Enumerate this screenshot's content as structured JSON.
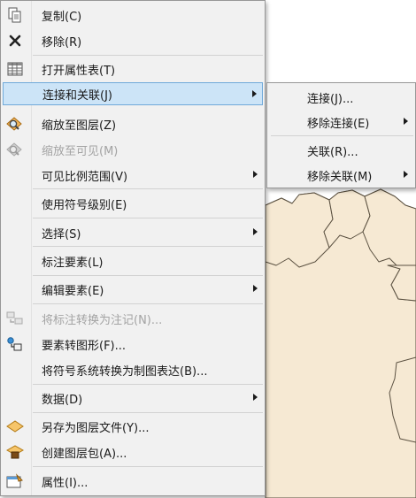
{
  "context_menu": {
    "items": [
      {
        "label": "复制(C)",
        "icon": "copy-icon"
      },
      {
        "label": "移除(R)",
        "icon": "remove-x-icon"
      },
      {
        "label": "打开属性表(T)",
        "icon": "attribute-table-icon"
      },
      {
        "label": "连接和关联(J)",
        "icon": "",
        "submenu": true,
        "highlighted": true
      },
      {
        "label": "缩放至图层(Z)",
        "icon": "zoom-to-layer-icon"
      },
      {
        "label": "缩放至可见(M)",
        "icon": "zoom-to-visible-icon",
        "disabled": true
      },
      {
        "label": "可见比例范围(V)",
        "icon": "",
        "submenu": true
      },
      {
        "label": "使用符号级别(E)",
        "icon": ""
      },
      {
        "label": "选择(S)",
        "icon": "",
        "submenu": true
      },
      {
        "label": "标注要素(L)",
        "icon": ""
      },
      {
        "label": "编辑要素(E)",
        "icon": "",
        "submenu": true
      },
      {
        "label": "将标注转换为注记(N)...",
        "icon": "convert-labels-icon",
        "disabled": true
      },
      {
        "label": "要素转图形(F)...",
        "icon": "features-to-graphics-icon"
      },
      {
        "label": "将符号系统转换为制图表达(B)...",
        "icon": ""
      },
      {
        "label": "数据(D)",
        "icon": "",
        "submenu": true
      },
      {
        "label": "另存为图层文件(Y)...",
        "icon": "save-layer-file-icon"
      },
      {
        "label": "创建图层包(A)...",
        "icon": "layer-package-icon"
      },
      {
        "label": "属性(I)...",
        "icon": "properties-icon"
      }
    ]
  },
  "submenu": {
    "items": [
      {
        "label": "连接(J)..."
      },
      {
        "label": "移除连接(E)",
        "submenu": true
      },
      {
        "label": "关联(R)..."
      },
      {
        "label": "移除关联(M)",
        "submenu": true
      }
    ]
  },
  "colors": {
    "map_fill": "#f6e9d3",
    "map_border": "#5a5040",
    "highlight": "#cce4f7",
    "menu_bg": "#f1f1f1"
  }
}
